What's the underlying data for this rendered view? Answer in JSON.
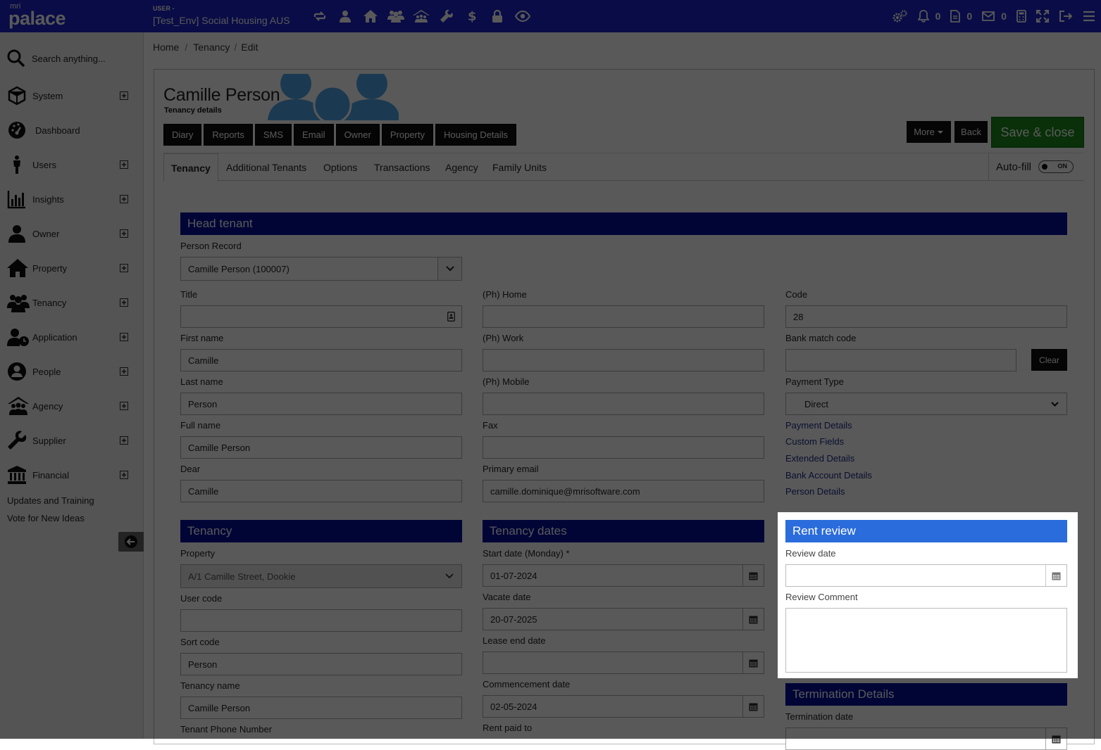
{
  "header": {
    "logo_small": "mri",
    "logo_name": "palace",
    "user_label": "USER -",
    "environment": "[Test_Env] Social Housing AUS",
    "nav_icons": [
      "swap-icon",
      "person-icon",
      "home-icon",
      "people-group-icon",
      "agency-icon",
      "wrench-icon",
      "dollar-icon",
      "lock-icon",
      "eye-icon"
    ],
    "notifications_count": "0",
    "documents_count": "0",
    "messages_count": "0"
  },
  "sidebar": {
    "search_placeholder": "Search anything...",
    "items": [
      {
        "label": "System",
        "icon": "cube-icon"
      },
      {
        "label": "Dashboard",
        "icon": "gauge-icon"
      },
      {
        "label": "Users",
        "icon": "person-standing-icon"
      },
      {
        "label": "Insights",
        "icon": "bar-chart-icon"
      },
      {
        "label": "Owner",
        "icon": "person-icon"
      },
      {
        "label": "Property",
        "icon": "house-icon"
      },
      {
        "label": "Tenancy",
        "icon": "people-icon"
      },
      {
        "label": "Application",
        "icon": "person-clock-icon"
      },
      {
        "label": "People",
        "icon": "person-circle-icon"
      },
      {
        "label": "Agency",
        "icon": "agency-icon"
      },
      {
        "label": "Supplier",
        "icon": "wrench-icon"
      },
      {
        "label": "Financial",
        "icon": "bank-icon"
      }
    ],
    "updates_link": "Updates and Training",
    "vote_link": "Vote for New Ideas"
  },
  "breadcrumb": [
    "Home",
    "Tenancy",
    "Edit"
  ],
  "record": {
    "name": "Camille Person",
    "subtitle": "Tenancy details"
  },
  "action_buttons": [
    "Diary",
    "Reports",
    "SMS",
    "Email",
    "Owner",
    "Property",
    "Housing Details"
  ],
  "toolbar": {
    "more_label": "More",
    "back_label": "Back",
    "save_label": "Save & close"
  },
  "tabs": [
    "Tenancy",
    "Additional Tenants",
    "Options",
    "Transactions",
    "Agency",
    "Family Units"
  ],
  "autofill": {
    "label": "Auto-fill",
    "state": "ON"
  },
  "head_tenant": {
    "title": "Head tenant",
    "person_record_label": "Person Record",
    "person_record_value": "Camille Person (100007)",
    "title_label": "Title",
    "title_value": "",
    "first_name_label": "First name",
    "first_name_value": "Camille",
    "last_name_label": "Last name",
    "last_name_value": "Person",
    "full_name_label": "Full name",
    "full_name_value": "Camille Person",
    "dear_label": "Dear",
    "dear_value": "Camille",
    "ph_home_label": "(Ph) Home",
    "ph_home_value": "",
    "ph_work_label": "(Ph) Work",
    "ph_work_value": "",
    "ph_mobile_label": "(Ph) Mobile",
    "ph_mobile_value": "",
    "fax_label": "Fax",
    "fax_value": "",
    "email_label": "Primary email",
    "email_value": "camille.dominique@mrisoftware.com",
    "code_label": "Code",
    "code_value": "28",
    "bank_match_label": "Bank match code",
    "bank_match_value": "",
    "clear_label": "Clear",
    "payment_type_label": "Payment Type",
    "payment_type_value": "Direct",
    "links": [
      "Payment Details",
      "Custom Fields",
      "Extended Details",
      "Bank Account Details",
      "Person Details"
    ]
  },
  "tenancy": {
    "title": "Tenancy",
    "property_label": "Property",
    "property_value": "A/1 Camille Street, Dookie",
    "user_code_label": "User code",
    "user_code_value": "",
    "sort_code_label": "Sort code",
    "sort_code_value": "Person",
    "tenancy_name_label": "Tenancy name",
    "tenancy_name_value": "Camille Person",
    "tenant_phone_label": "Tenant Phone Number"
  },
  "tenancy_dates": {
    "title": "Tenancy dates",
    "start_label": "Start date (Monday) *",
    "start_value": "01-07-2024",
    "vacate_label": "Vacate date",
    "vacate_value": "20-07-2025",
    "lease_end_label": "Lease end date",
    "lease_end_value": "",
    "commencement_label": "Commencement date",
    "commencement_value": "02-05-2024",
    "rent_paid_label": "Rent paid to"
  },
  "rent_review": {
    "title": "Rent review",
    "review_date_label": "Review date",
    "review_date_value": "",
    "review_comment_label": "Review Comment"
  },
  "termination": {
    "title": "Termination Details",
    "termination_date_label": "Termination date"
  }
}
